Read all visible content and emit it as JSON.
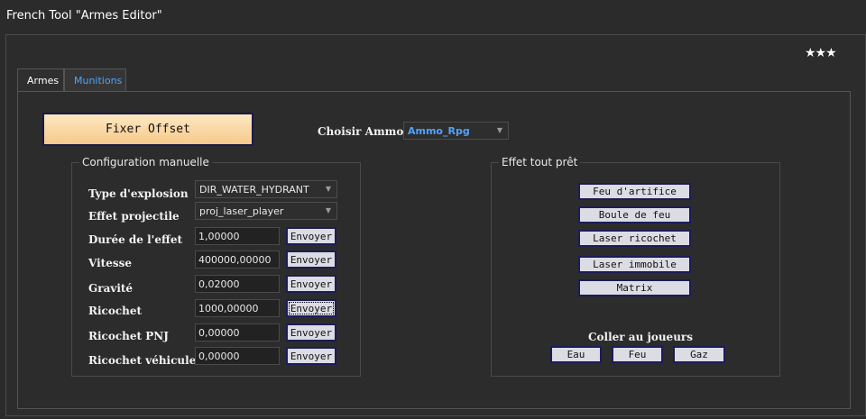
{
  "window": {
    "title": "French Tool \"Armes Editor\""
  },
  "rating": {
    "stars": "★★★"
  },
  "tabs": [
    {
      "label": "Armes"
    },
    {
      "label": "Munitions"
    }
  ],
  "munitions": {
    "fix_offset_label": "Fixer Offset",
    "choose_ammo_label": "Choisir Ammo",
    "ammo_selected": "Ammo_Rpg",
    "manual": {
      "title": "Configuration manuelle",
      "explosion_type": {
        "label": "Type d'explosion",
        "value": "DIR_WATER_HYDRANT"
      },
      "projectile_effect": {
        "label": "Effet projectile",
        "value": "proj_laser_player"
      },
      "send_label": "Envoyer",
      "rows": [
        {
          "label": "Durée de l'effet",
          "value": "1,00000"
        },
        {
          "label": "Vitesse",
          "value": "400000,00000"
        },
        {
          "label": "Gravité",
          "value": "0,02000"
        },
        {
          "label": "Ricochet",
          "value": "1000,00000"
        },
        {
          "label": "Ricochet PNJ",
          "value": "0,00000"
        },
        {
          "label": "Ricochet véhicules",
          "value": "0,00000"
        }
      ]
    },
    "ready": {
      "title": "Effet tout prêt",
      "effects": [
        {
          "label": "Feu d'artifice"
        },
        {
          "label": "Boule de feu"
        },
        {
          "label": "Laser ricochet"
        },
        {
          "label": "Laser immobile"
        },
        {
          "label": "Matrix"
        }
      ],
      "stick_label": "Coller au joueurs",
      "stick_buttons": [
        {
          "label": "Eau"
        },
        {
          "label": "Feu"
        },
        {
          "label": "Gaz"
        }
      ]
    }
  }
}
